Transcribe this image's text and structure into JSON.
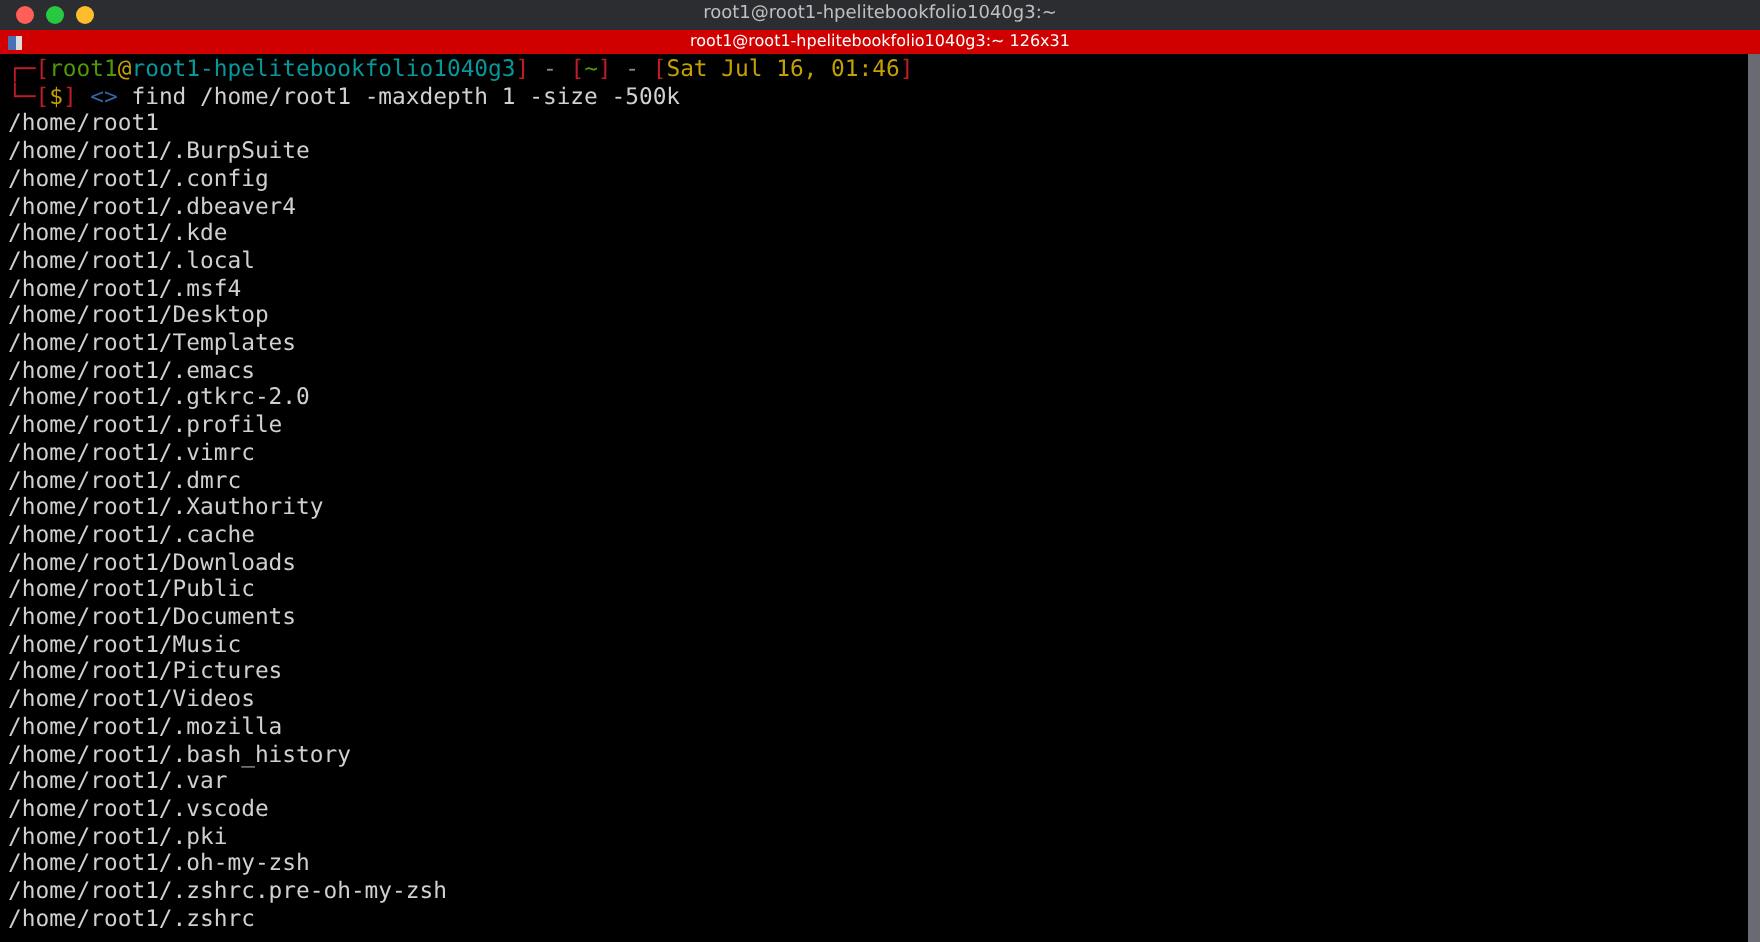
{
  "window": {
    "title": "root1@root1-hpelitebookfolio1040g3:~"
  },
  "tab": {
    "title": "root1@root1-hpelitebookfolio1040g3:~ 126x31"
  },
  "prompt": {
    "line1": [
      {
        "text": "┌─[",
        "color": "#c01c28"
      },
      {
        "text": "root1",
        "color": "#4e9a06"
      },
      {
        "text": "@",
        "color": "#c4a000"
      },
      {
        "text": "root1-hpelitebookfolio1040g3",
        "color": "#06989a"
      },
      {
        "text": "]",
        "color": "#c01c28"
      },
      {
        "text": " - ",
        "color": "#8a8a8a"
      },
      {
        "text": "[",
        "color": "#c01c28"
      },
      {
        "text": "~",
        "color": "#4e9a06"
      },
      {
        "text": "]",
        "color": "#c01c28"
      },
      {
        "text": " - ",
        "color": "#8a8a8a"
      },
      {
        "text": "[",
        "color": "#c01c28"
      },
      {
        "text": "Sat Jul 16, 01:46",
        "color": "#c4a000"
      },
      {
        "text": "]",
        "color": "#c01c28"
      }
    ],
    "line2": [
      {
        "text": "└─[",
        "color": "#c01c28"
      },
      {
        "text": "$",
        "color": "#c4a000"
      },
      {
        "text": "]",
        "color": "#c01c28"
      },
      {
        "text": " <>",
        "color": "#3465a4"
      },
      {
        "text": " find /home/root1 -maxdepth 1 -size -500k",
        "color": "#d0d0d0"
      }
    ]
  },
  "output": [
    "/home/root1",
    "/home/root1/.BurpSuite",
    "/home/root1/.config",
    "/home/root1/.dbeaver4",
    "/home/root1/.kde",
    "/home/root1/.local",
    "/home/root1/.msf4",
    "/home/root1/Desktop",
    "/home/root1/Templates",
    "/home/root1/.emacs",
    "/home/root1/.gtkrc-2.0",
    "/home/root1/.profile",
    "/home/root1/.vimrc",
    "/home/root1/.dmrc",
    "/home/root1/.Xauthority",
    "/home/root1/.cache",
    "/home/root1/Downloads",
    "/home/root1/Public",
    "/home/root1/Documents",
    "/home/root1/Music",
    "/home/root1/Pictures",
    "/home/root1/Videos",
    "/home/root1/.mozilla",
    "/home/root1/.bash_history",
    "/home/root1/.var",
    "/home/root1/.vscode",
    "/home/root1/.pki",
    "/home/root1/.oh-my-zsh",
    "/home/root1/.zshrc.pre-oh-my-zsh",
    "/home/root1/.zshrc"
  ]
}
